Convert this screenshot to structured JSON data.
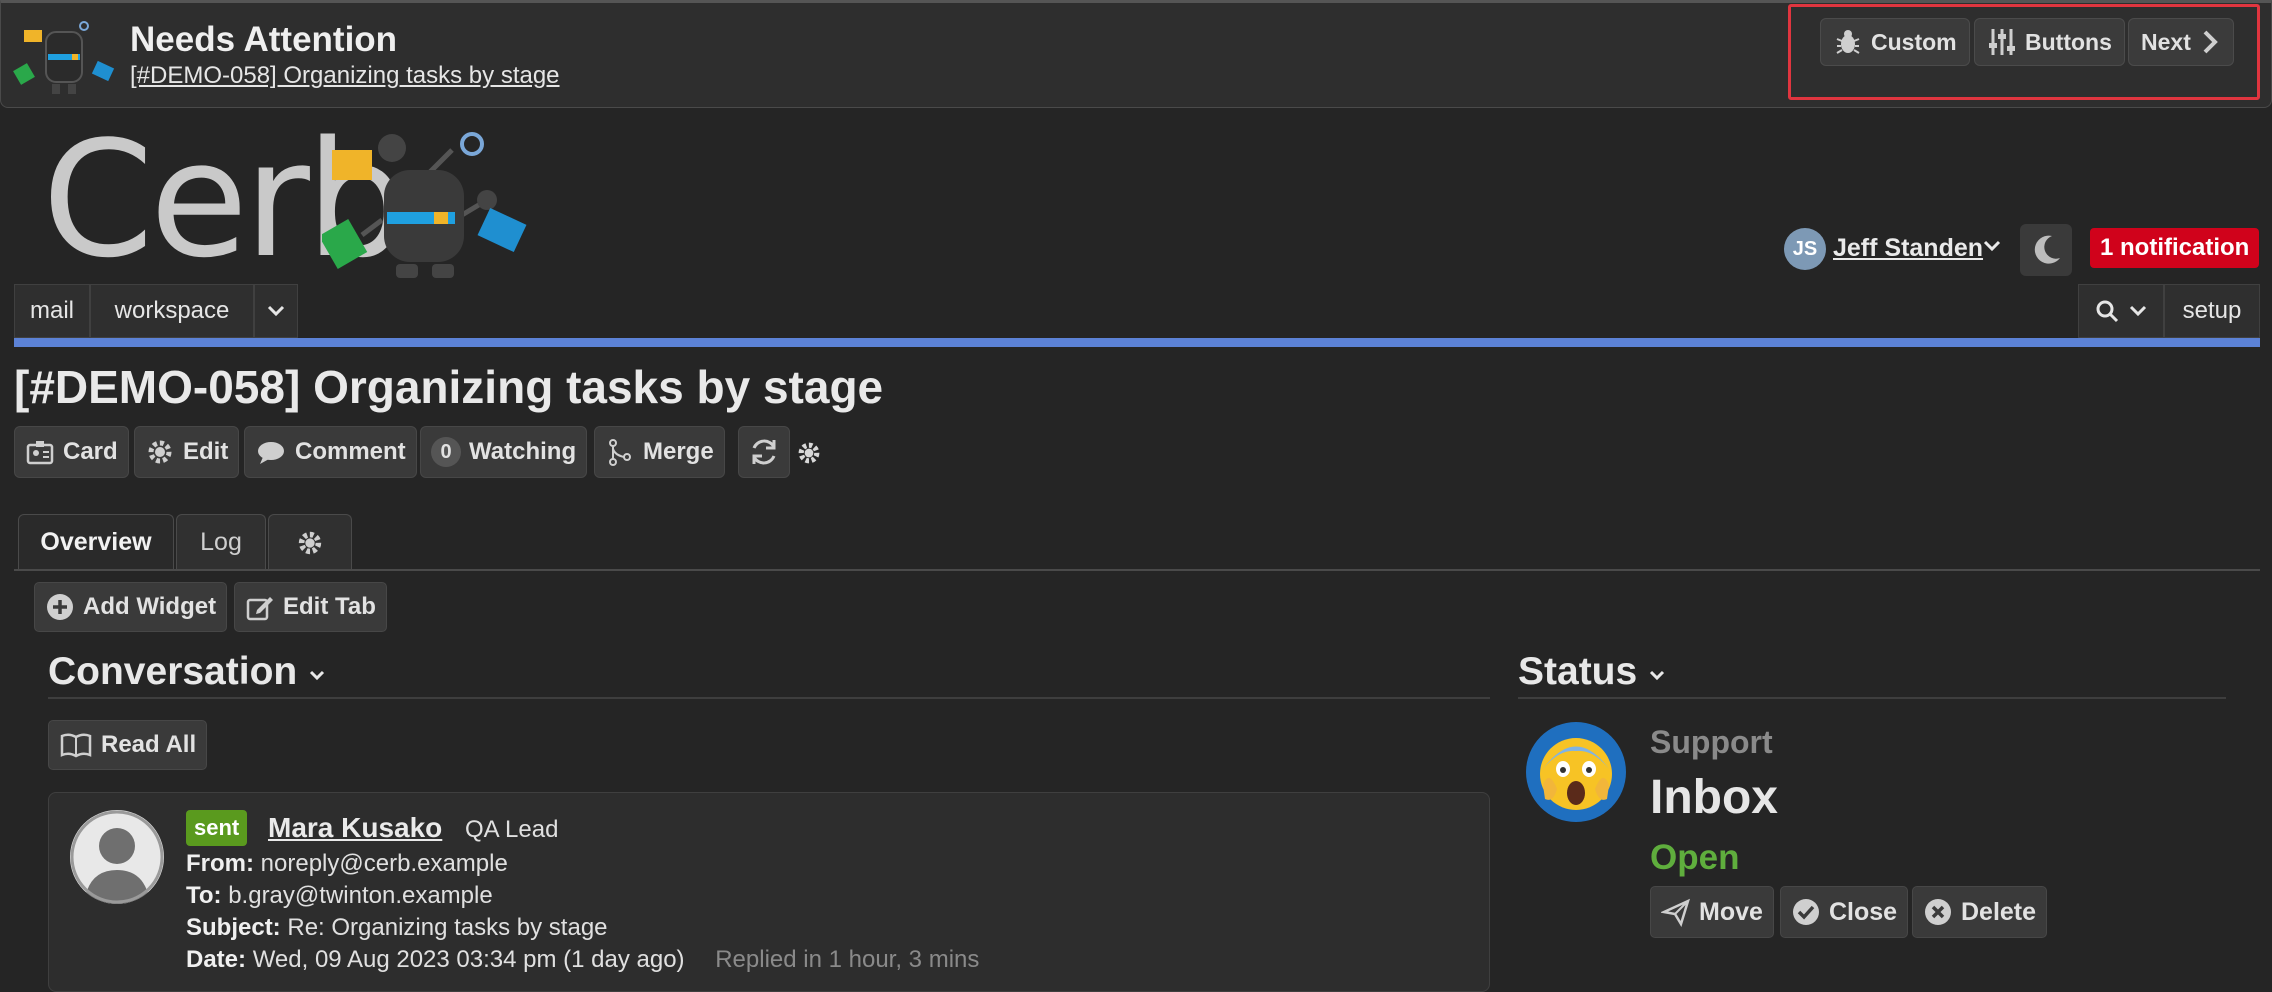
{
  "topbar": {
    "title": "Needs Attention",
    "subtitle": "[#DEMO-058] Organizing tasks by stage",
    "buttons": {
      "custom": "Custom",
      "buttons": "Buttons",
      "next": "Next"
    },
    "highlight_color": "#e0353f"
  },
  "logo": {
    "text": "Cerb"
  },
  "user": {
    "initials": "JS",
    "name": "Jeff Standen",
    "notification": "1 notification",
    "notification_color": "#d0021b"
  },
  "nav": {
    "items": [
      "mail",
      "workspace"
    ],
    "setup": "setup",
    "accent_color": "#5c82d6"
  },
  "page": {
    "title": "[#DEMO-058] Organizing tasks by stage",
    "actions": {
      "card": "Card",
      "edit": "Edit",
      "comment": "Comment",
      "watching_count": "0",
      "watching": "Watching",
      "merge": "Merge"
    }
  },
  "tabs": {
    "overview": "Overview",
    "log": "Log"
  },
  "widget_toolbar": {
    "add_widget": "Add Widget",
    "edit_tab": "Edit Tab"
  },
  "conversation": {
    "title": "Conversation",
    "read_all": "Read All",
    "message": {
      "badge": "sent",
      "sender": "Mara Kusako",
      "sender_title": "QA Lead",
      "from_label": "From:",
      "from": "noreply@cerb.example",
      "to_label": "To:",
      "to": "b.gray@twinton.example",
      "subject_label": "Subject:",
      "subject": "Re: Organizing tasks by stage",
      "date_label": "Date:",
      "date": "Wed, 09 Aug 2023 03:34 pm (1 day ago)",
      "replied": "Replied in 1 hour, 3 mins"
    }
  },
  "status": {
    "title": "Status",
    "group": "Support",
    "bucket": "Inbox",
    "state": "Open",
    "state_color": "#5fae3d",
    "actions": {
      "move": "Move",
      "close": "Close",
      "delete": "Delete"
    }
  }
}
